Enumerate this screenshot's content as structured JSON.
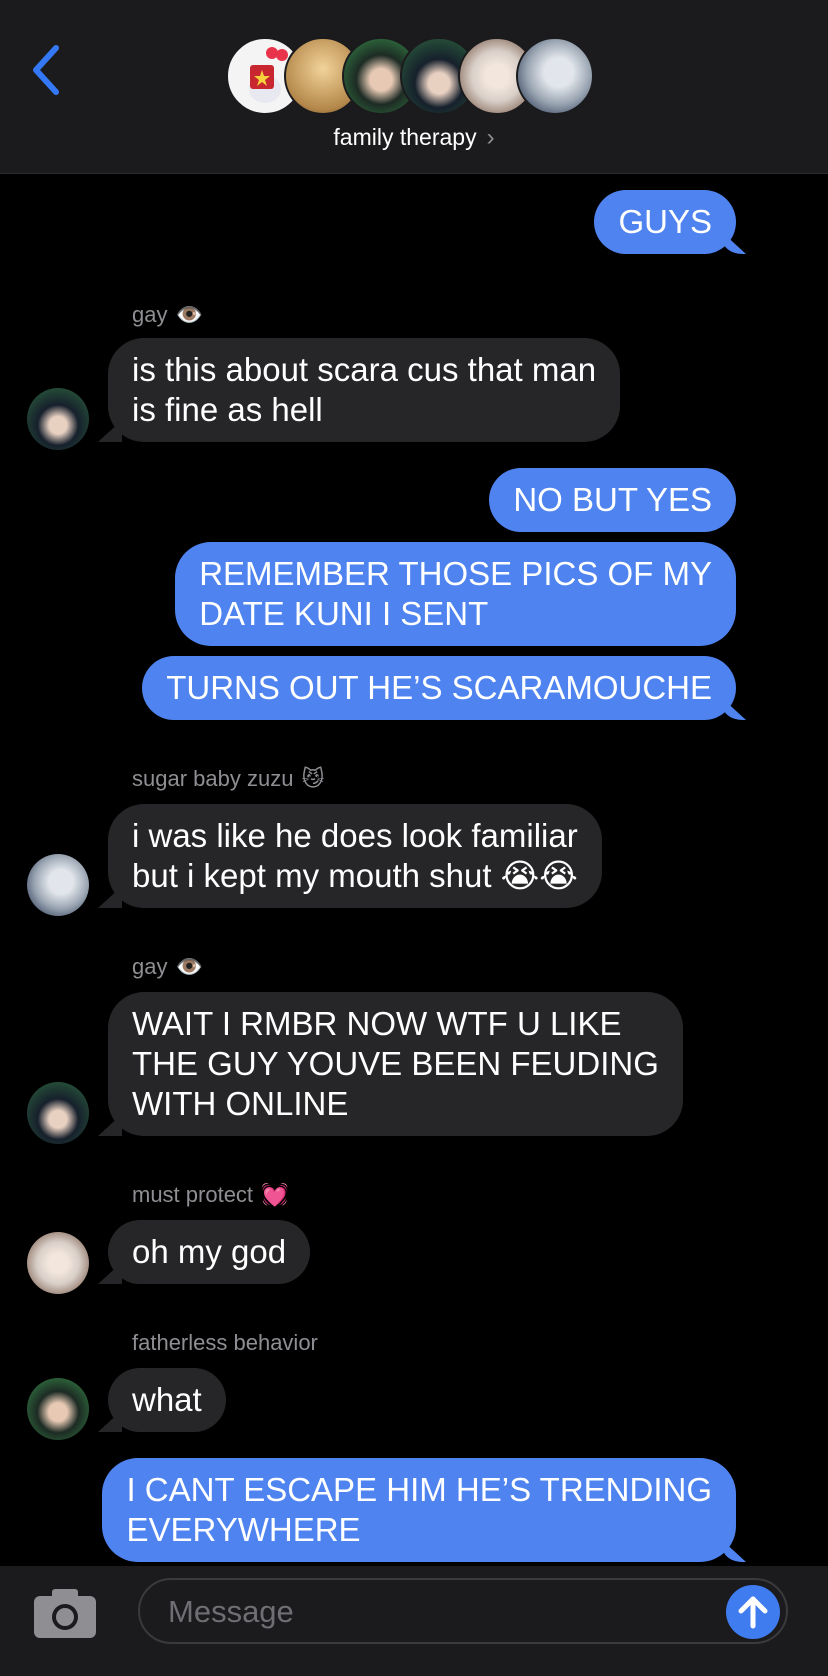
{
  "header": {
    "title": "family therapy",
    "avatars": [
      {
        "name": "hello-kitty-avatar",
        "color": "#f4f4f4"
      },
      {
        "name": "blond-avatar",
        "color": "#d8b27a"
      },
      {
        "name": "green-hair-avatar",
        "color": "#274a36"
      },
      {
        "name": "dark-hair-avatar",
        "color": "#1d2d3a"
      },
      {
        "name": "white-hair-avatar",
        "color": "#cfc3b8"
      },
      {
        "name": "silver-hair-avatar",
        "color": "#8e9aa8"
      }
    ]
  },
  "messages": [
    {
      "dir": "out",
      "text": "GUYS"
    },
    {
      "sender": "gay",
      "sender_emoji": "👁️",
      "dir": "in",
      "text": "is this about scara cus that man\nis fine as hell"
    },
    {
      "dir": "out",
      "text": "NO BUT YES"
    },
    {
      "dir": "out",
      "text": "REMEMBER THOSE PICS OF MY\nDATE KUNI I SENT"
    },
    {
      "dir": "out",
      "text": "TURNS OUT HE’S SCARAMOUCHE"
    },
    {
      "sender": "sugar baby zuzu",
      "sender_emoji": "😼",
      "dir": "in",
      "text": "i was like he does look familiar\nbut i kept my mouth shut 😭😭"
    },
    {
      "sender": "gay",
      "sender_emoji": "👁️",
      "dir": "in",
      "text": "WAIT I RMBR NOW WTF U LIKE\nTHE GUY YOUVE BEEN FEUDING\nWITH ONLINE"
    },
    {
      "sender": "must protect",
      "sender_emoji": "💓",
      "dir": "in",
      "text": "oh my god"
    },
    {
      "sender": "fatherless behavior",
      "sender_emoji": "",
      "dir": "in",
      "text": "what"
    },
    {
      "dir": "out",
      "text": "I CANT ESCAPE HIM HE’S TRENDING\nEVERYWHERE"
    }
  ],
  "composer": {
    "placeholder": "Message"
  },
  "colors": {
    "outgoing": "#4f84f0",
    "incoming": "#262628",
    "accent": "#3f7cf0"
  }
}
